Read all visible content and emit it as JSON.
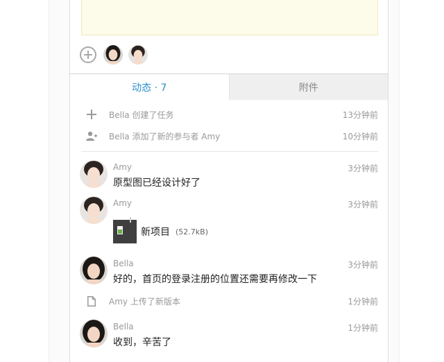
{
  "tabs": [
    {
      "label": "动态 · 7"
    },
    {
      "label": "附件"
    }
  ],
  "system_events": [
    {
      "icon": "plus-icon",
      "text": "Bella 创建了任务",
      "time": "13分钟前"
    },
    {
      "icon": "add-user-icon",
      "text": "Bella 添加了新的参与者 Amy",
      "time": "10分钟前"
    },
    {
      "icon": "document-icon",
      "text": "Amy 上传了新版本",
      "time": "1分钟前"
    }
  ],
  "messages": [
    {
      "name": "Amy",
      "time": "3分钟前",
      "text": "原型图已经设计好了"
    },
    {
      "name": "Amy",
      "time": "3分钟前",
      "file": {
        "name": "新项目",
        "size": "(52.7kB)"
      }
    },
    {
      "name": "Bella",
      "time": "3分钟前",
      "text": "好的，首页的登录注册的位置还需要再修改一下"
    },
    {
      "name": "Bella",
      "time": "1分钟前",
      "text": "收到，辛苦了"
    }
  ],
  "colors": {
    "accent": "#2b8ecf",
    "note_bg": "#fdfbe9",
    "muted": "#999999"
  }
}
